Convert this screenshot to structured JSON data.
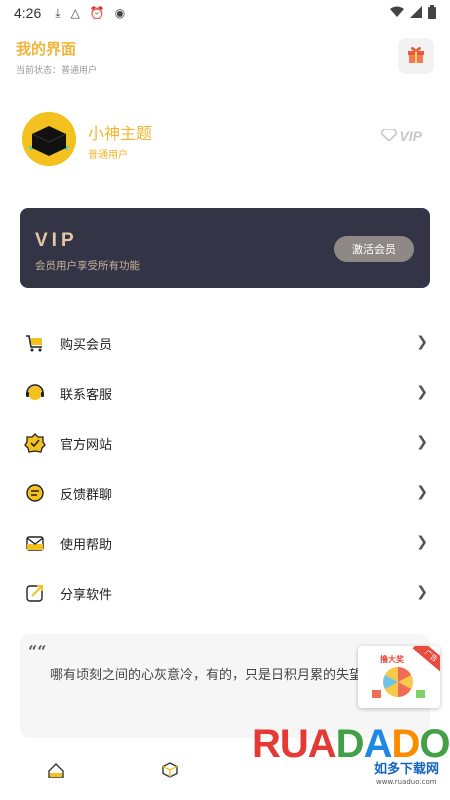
{
  "status_bar": {
    "time": "4:26",
    "icons": [
      "download-icon",
      "font-icon",
      "alarm-icon",
      "record-icon"
    ],
    "right_icons": [
      "wifi-icon",
      "signal-icon",
      "battery-icon"
    ]
  },
  "header": {
    "title": "我的界面",
    "subtitle": "当前状态：普通用户"
  },
  "profile": {
    "name": "小神主题",
    "role": "普通用户",
    "badge": "VIP"
  },
  "vip_card": {
    "title": "VIP",
    "description": "会员用户享受所有功能",
    "button": "激活会员",
    "colors": {
      "background": "#343447",
      "gold": "#e2c9a2"
    }
  },
  "menu": [
    {
      "label": "购买会员",
      "icon": "cart-icon"
    },
    {
      "label": "联系客服",
      "icon": "customer-service-icon"
    },
    {
      "label": "官方网站",
      "icon": "website-badge-icon"
    },
    {
      "label": "反馈群聊",
      "icon": "chat-icon"
    },
    {
      "label": "使用帮助",
      "icon": "help-mail-icon"
    },
    {
      "label": "分享软件",
      "icon": "share-icon"
    }
  ],
  "quote": {
    "mark": "““",
    "text": "哪有顷刻之间的心灰意冷，有的，只是日积月累的失望罢了。"
  },
  "promo": {
    "title": "撸大奖",
    "ribbon": "广告"
  },
  "watermark": {
    "brand_letters": [
      "R",
      "U",
      "A",
      "D",
      "A",
      "D",
      "O"
    ],
    "chinese": "如多下载网",
    "url": "www.ruaduo.com"
  },
  "accent_color": "#f2b53a"
}
